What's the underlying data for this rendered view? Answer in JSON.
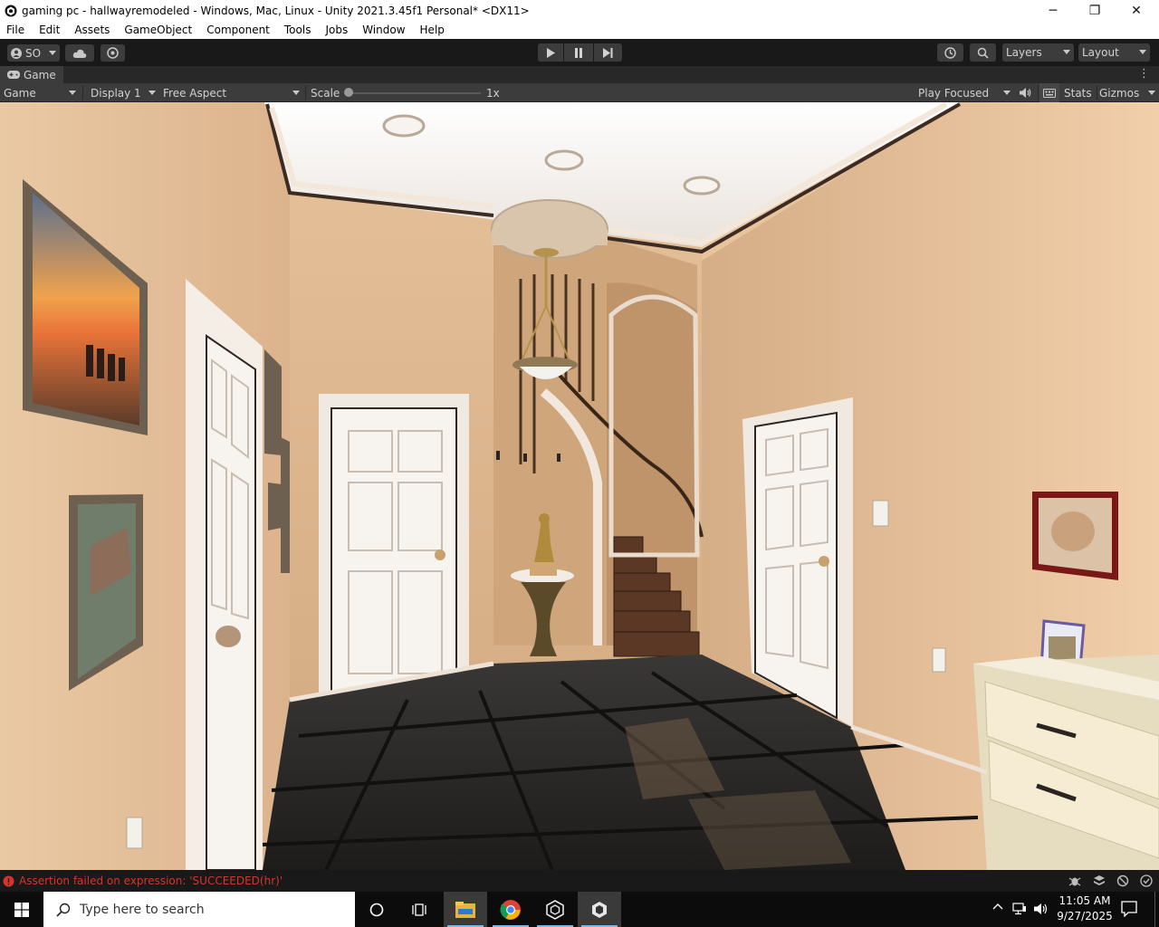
{
  "window": {
    "title": "gaming pc - hallwayremodeled - Windows, Mac, Linux - Unity 2021.3.45f1 Personal* <DX11>",
    "controls": {
      "minimize": "─",
      "restore": "❐",
      "close": "✕"
    }
  },
  "menu": [
    "File",
    "Edit",
    "Assets",
    "GameObject",
    "Component",
    "Tools",
    "Jobs",
    "Window",
    "Help"
  ],
  "toolbar": {
    "account_label": "SO",
    "layers_label": "Layers",
    "layout_label": "Layout",
    "icons": [
      "account-icon",
      "cloud-icon",
      "settings-icon",
      "play-icon",
      "pause-icon",
      "step-icon",
      "history-icon",
      "search-icon"
    ]
  },
  "game_tab": {
    "tab_label": "Game",
    "view_dropdown": "Game",
    "display_dropdown": "Display 1",
    "aspect_dropdown": "Free Aspect",
    "scale_label": "Scale",
    "scale_value": "1x",
    "scale_fraction": 0.0,
    "play_mode_dropdown": "Play Focused",
    "stats_label": "Stats",
    "gizmos_label": "Gizmos"
  },
  "status": {
    "message": "Assertion failed on expression: 'SUCCEEDED(hr)'",
    "color": "#d9342b"
  },
  "taskbar": {
    "search_placeholder": "Type here to search",
    "time": "11:05 AM",
    "date": "9/27/2025",
    "apps": [
      "cortana-icon",
      "task-view-icon",
      "file-explorer-icon",
      "chrome-icon",
      "unity-hub-icon",
      "unity-editor-icon"
    ]
  },
  "colors": {
    "accent": "#76b9ed",
    "editor_dark": "#191919",
    "panel": "#3c3c3c",
    "wall": "#e8c49c"
  }
}
